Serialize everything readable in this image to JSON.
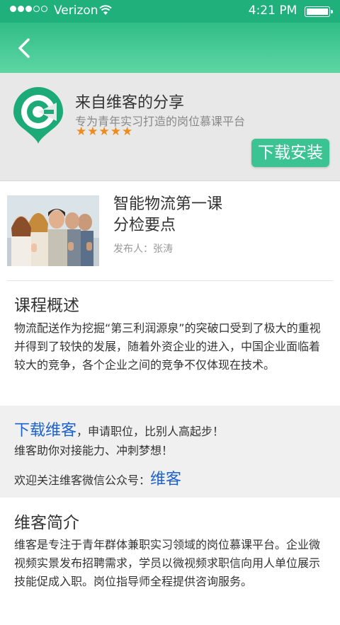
{
  "status_bar": {
    "carrier": "Verizon",
    "time": "4:21 PM"
  },
  "app_banner": {
    "name": "来自维客的分享",
    "slogan": "专为青年实习打造的岗位慕课平台",
    "rating": "★★★★★",
    "download_label": "下载安装"
  },
  "course": {
    "title_line1": "智能物流第一课",
    "title_line2": "分检要点",
    "publisher": "发布人：张涛"
  },
  "overview": {
    "heading": "课程概述",
    "text": "物流配送作为挖掘“第三利润源泉”的突破口受到了极大的重视并得到了较快的发展，随着外资企业的进入，中国企业面临着较大的竞争，各个企业之间的竞争不仅体现在技术。"
  },
  "promo": {
    "download_link": "下载维客",
    "line1_rest": "，申请职位，比别人高起步！",
    "line2": "维客助你对接能力、冲刺梦想！",
    "line3_prefix": "欢迎关注维客微信公众号：",
    "wechat_link": "维客"
  },
  "about": {
    "heading": "维客简介",
    "text": "维客是专注于青年群体兼职实习领域的岗位慕课平台。企业微视频实景发布招聘需求，学员以微视频求职信向用人单位展示技能促成入职。岗位指导师全程提供咨询服务。"
  },
  "icons": {
    "back": "chevron-left-icon",
    "wifi": "wifi-icon",
    "battery": "battery-icon",
    "logo": "weike-logo"
  },
  "colors": {
    "brand_green": "#1fb07c",
    "button_green": "#3cc394",
    "link_blue": "#1e62d0",
    "star_orange": "#f08a1c"
  }
}
